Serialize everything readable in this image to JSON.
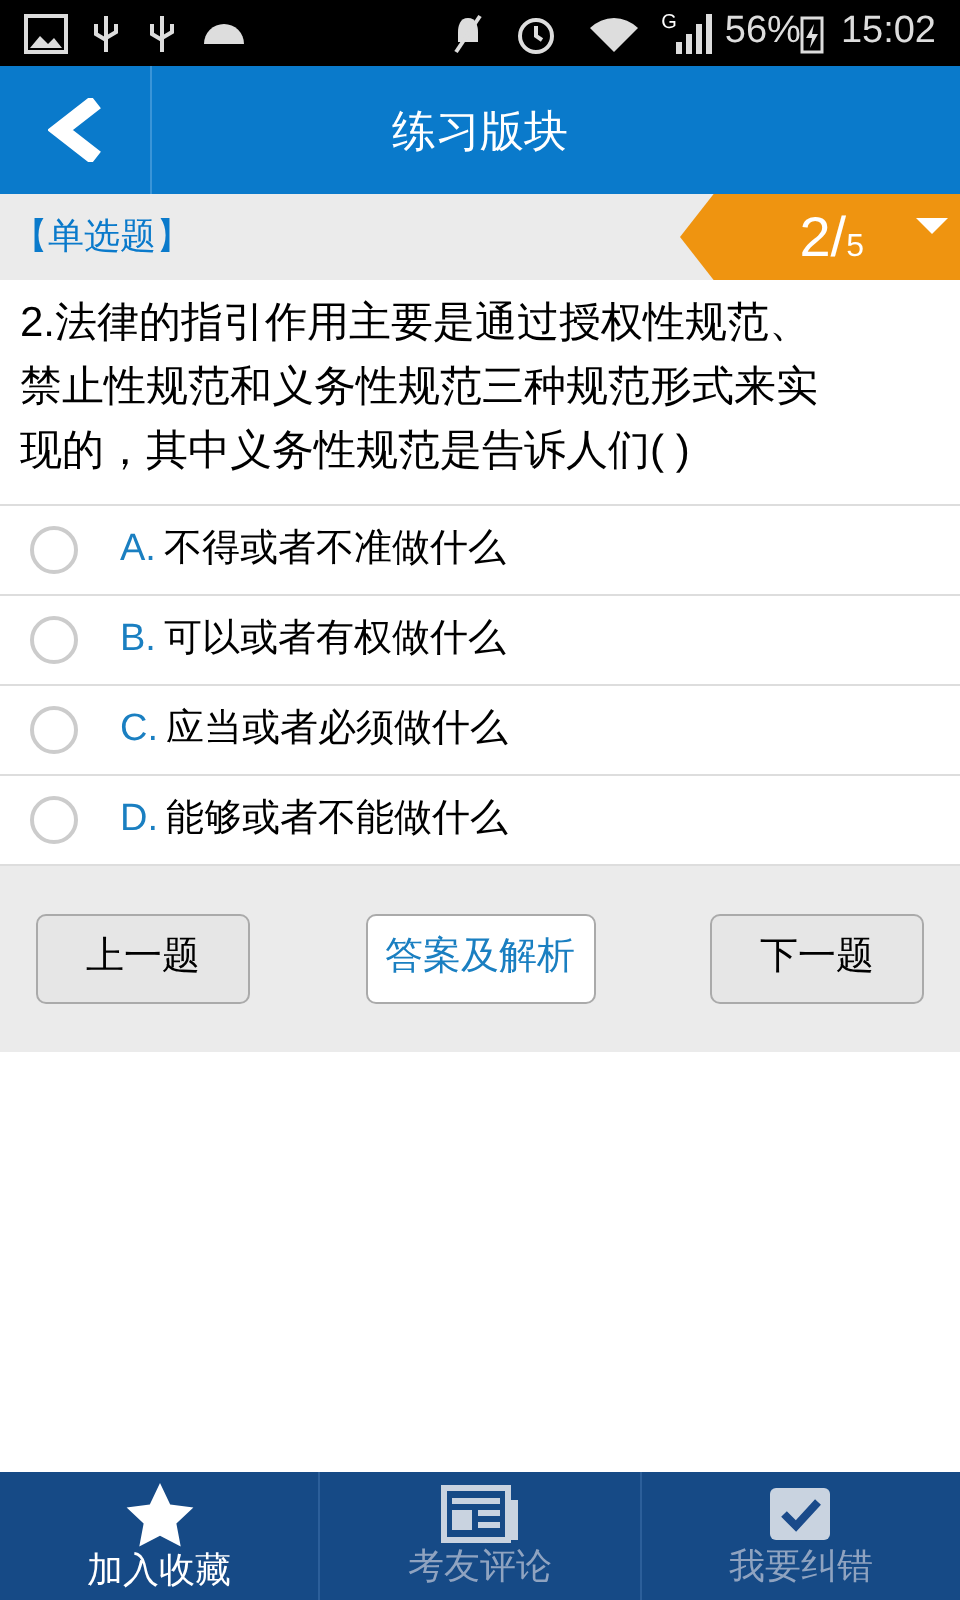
{
  "status_bar": {
    "network": "G",
    "battery": "56%",
    "time": "15:02"
  },
  "header": {
    "title": "练习版块"
  },
  "question_bar": {
    "type_label": "【单选题】",
    "current": "2/",
    "total": "5"
  },
  "question": {
    "text": "2.法律的指引作用主要是通过授权性规范、禁止性规范和义务性规范三种规范形式来实现的，其中义务性规范是告诉人们( )"
  },
  "options": [
    {
      "letter": "A.",
      "text": "不得或者不准做什么",
      "selected": false
    },
    {
      "letter": "B.",
      "text": "可以或者有权做什么",
      "selected": false
    },
    {
      "letter": "C.",
      "text": "应当或者必须做什么",
      "selected": false
    },
    {
      "letter": "D.",
      "text": "能够或者不能做什么",
      "selected": false
    }
  ],
  "buttons": [
    {
      "label": "上一题",
      "kind": "nav"
    },
    {
      "label": "答案及解析",
      "kind": "answer"
    },
    {
      "label": "下一题",
      "kind": "nav"
    }
  ],
  "bottom_nav": [
    {
      "label": "加入收藏",
      "kind": "star",
      "selected": true
    },
    {
      "label": "考友评论",
      "kind": "news",
      "selected": false
    },
    {
      "label": "我要纠错",
      "kind": "check",
      "selected": false
    }
  ]
}
